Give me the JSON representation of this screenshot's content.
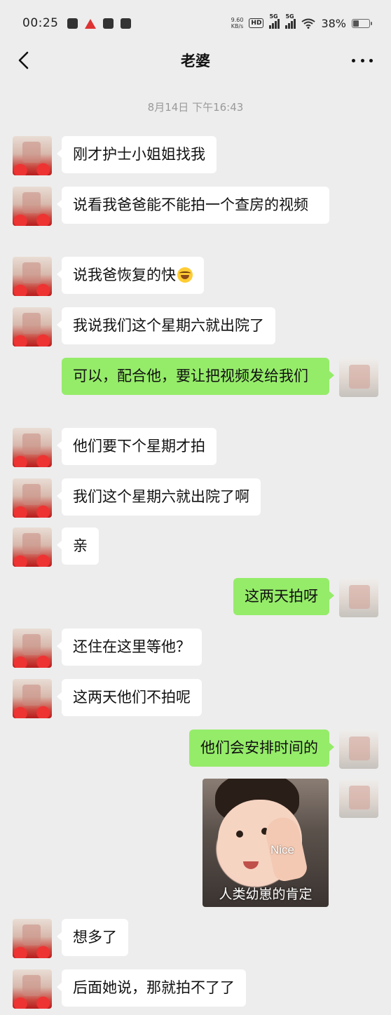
{
  "status_bar": {
    "time": "00:25",
    "net_speed_value": "9.60",
    "net_speed_unit": "KB/s",
    "hd_label": "HD",
    "sim1_label": "5G",
    "sim2_label": "5G",
    "battery_percent": "38%",
    "battery_level": 0.38
  },
  "nav": {
    "title": "老婆"
  },
  "timestamp": "8月14日 下午16:43",
  "messages": [
    {
      "from": "her",
      "text": "刚才护士小姐姐找我"
    },
    {
      "from": "her",
      "text": "说看我爸爸能不能拍一个查房的视频"
    },
    {
      "from": "her",
      "text": "说我爸恢复的快",
      "emoji": "grin-sweat-icon"
    },
    {
      "from": "her",
      "text": "我说我们这个星期六就出院了"
    },
    {
      "from": "me",
      "text": "可以，配合他，要让把视频发给我们"
    },
    {
      "from": "her",
      "text": "他们要下个星期才拍"
    },
    {
      "from": "her",
      "text": "我们这个星期六就出院了啊"
    },
    {
      "from": "her",
      "text": "亲"
    },
    {
      "from": "me",
      "text": "这两天拍呀"
    },
    {
      "from": "her",
      "text": "还住在这里等他？"
    },
    {
      "from": "her",
      "text": "这两天他们不拍呢"
    },
    {
      "from": "me",
      "text": "他们会安排时间的"
    },
    {
      "from": "me",
      "type": "sticker",
      "sticker_text": "Nice",
      "sticker_caption": "人类幼崽的肯定"
    },
    {
      "from": "her",
      "text": "想多了"
    },
    {
      "from": "her",
      "text": "后面她说，那就拍不了了"
    }
  ],
  "colors": {
    "background": "#ededed",
    "incoming_bubble": "#ffffff",
    "outgoing_bubble": "#95ec69"
  }
}
